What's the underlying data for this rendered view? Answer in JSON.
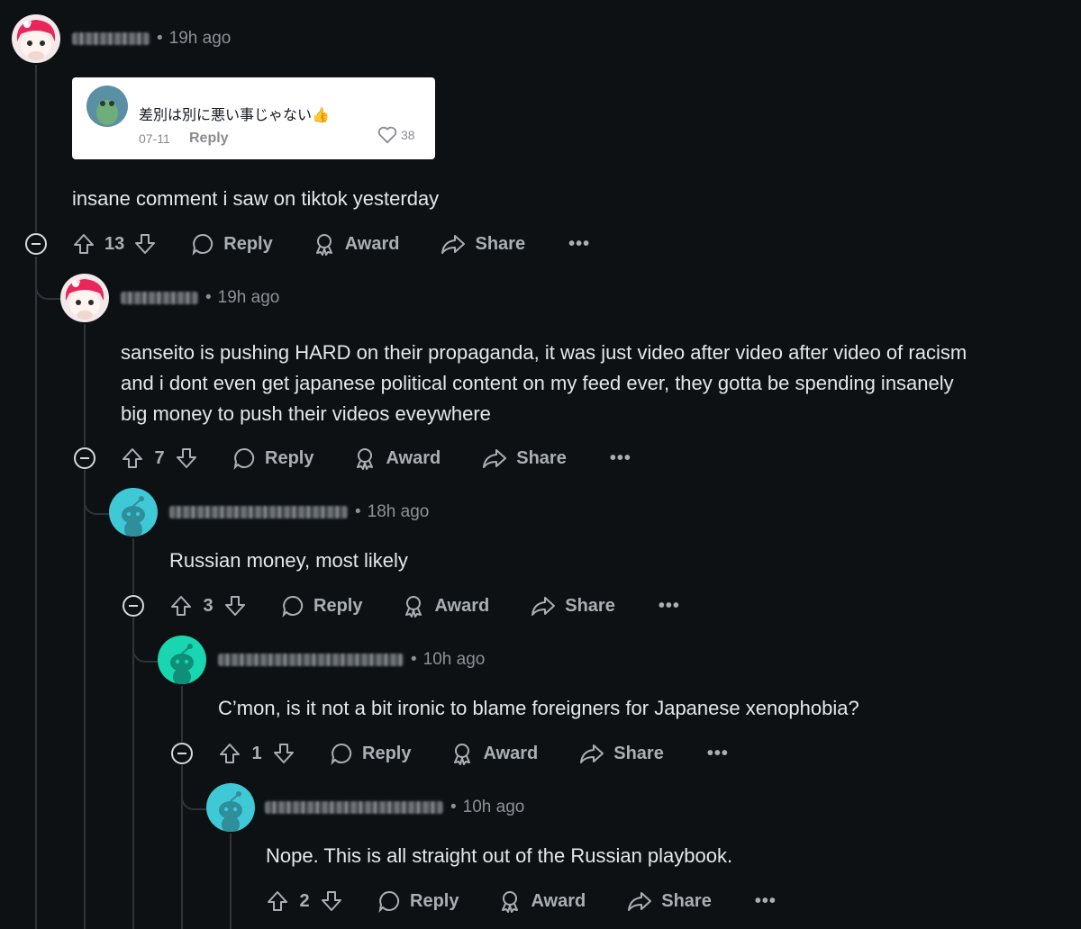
{
  "comments": [
    {
      "time": "19h ago",
      "text": "insane comment i saw on tiktok yesterday",
      "votes": "13",
      "embed": {
        "username": "",
        "text": "差別は別に悪い事じゃない👍",
        "date": "07-11",
        "reply_label": "Reply",
        "likes": "38"
      }
    },
    {
      "time": "19h ago",
      "text_lines": [
        "sanseito is pushing HARD on their propaganda, it was just video after video after video of racism",
        "and i dont even get japanese political content on my feed ever, they gotta be spending insanely",
        "big money to push their videos eveywhere"
      ],
      "votes": "7"
    },
    {
      "time": "18h ago",
      "text": "Russian money, most likely",
      "votes": "3"
    },
    {
      "time": "10h ago",
      "text": "C’mon, is it not a bit ironic to blame foreigners for Japanese xenophobia?",
      "votes": "1"
    },
    {
      "time": "10h ago",
      "text": "Nope. This is all straight out of the Russian playbook.",
      "votes": "2"
    }
  ],
  "actions": {
    "reply": "Reply",
    "award": "Award",
    "share": "Share",
    "more": "•••"
  },
  "separator": "•",
  "icons": [
    "collapse-icon",
    "upvote-icon",
    "downvote-icon",
    "reply-bubble-icon",
    "award-icon",
    "share-arrow-icon",
    "more-icon",
    "heart-icon"
  ],
  "colors": {
    "background": "#0e1113",
    "text": "#d7dadc",
    "muted": "#8b9296",
    "thread": "#2e3438"
  }
}
